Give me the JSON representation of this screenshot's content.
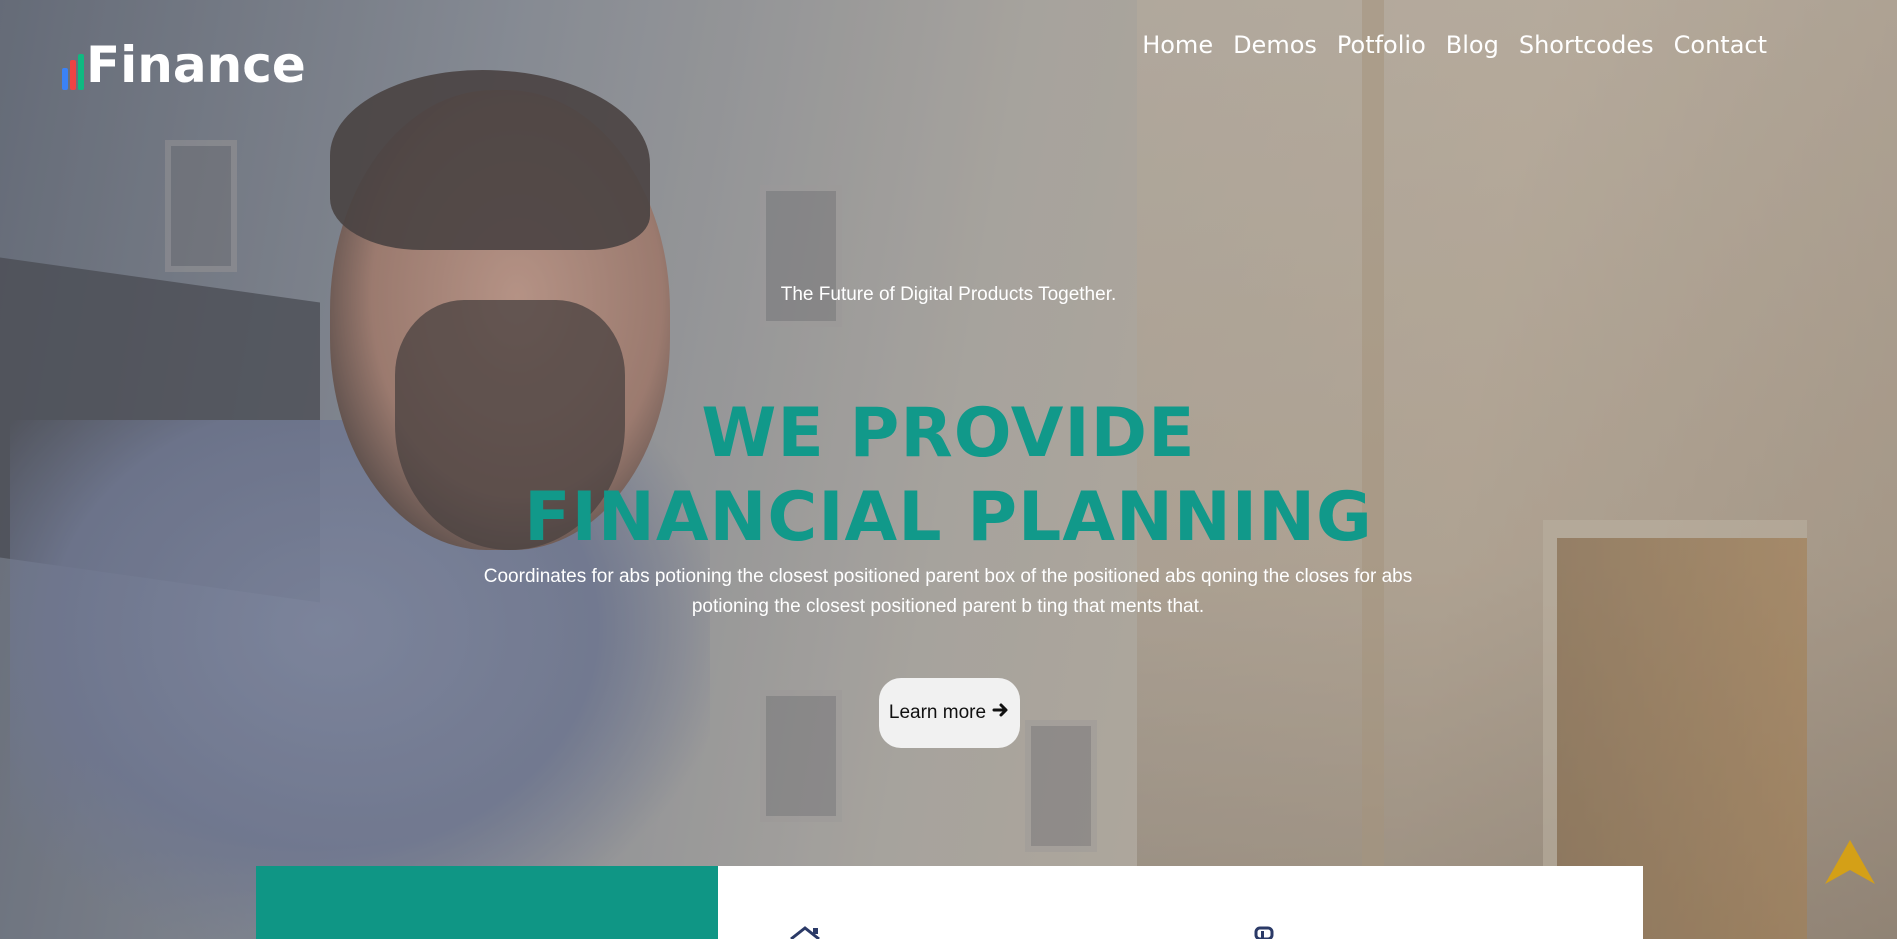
{
  "header": {
    "logo_text": "Finance",
    "logo_bar_colors": [
      "#3b82f6",
      "#ef4444",
      "#10b981"
    ],
    "nav": [
      {
        "label": "Home"
      },
      {
        "label": "Demos"
      },
      {
        "label": "Potfolio"
      },
      {
        "label": "Blog"
      },
      {
        "label": "Shortcodes"
      },
      {
        "label": "Contact"
      }
    ]
  },
  "hero": {
    "tagline": "The Future of Digital Products Together.",
    "headline_line1": "WE PROVIDE",
    "headline_line2": "FINANCIAL PLANNING",
    "headline_color": "#11998a",
    "description": "Coordinates for abs potioning the closest positioned parent box of the positioned abs qoning the closes for abs potioning the closest positioned parent b ting that ments that.",
    "cta_label": "Learn more",
    "cta_icon": "arrow-right-icon"
  },
  "panels": {
    "accent_color": "#0f9685",
    "icons": [
      "house-icon",
      "document-icon"
    ]
  },
  "scroll_top": {
    "icon": "arrow-up-icon",
    "color": "#d4a017"
  }
}
